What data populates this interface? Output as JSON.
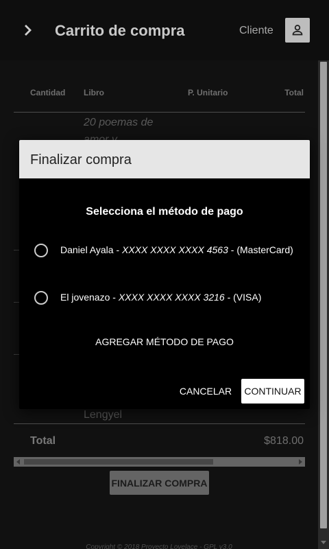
{
  "appbar": {
    "title": "Carrito de compra",
    "user_label": "Cliente",
    "menu_icon": "chevron-right-icon",
    "avatar_icon": "person-icon"
  },
  "table": {
    "headers": [
      "Cantidad",
      "Libro",
      "P. Unitario",
      "Total"
    ],
    "visible_book_title": "20 poemas de amor y",
    "visible_author": "Lengyel",
    "total_label": "Total",
    "total_value": "$818.00"
  },
  "finalize_button": "FINALIZAR COMPRA",
  "footer": "Copyright © 2018 Proyecto Lovelace - GPL v3.0",
  "dialog": {
    "title": "Finalizar compra",
    "subtitle": "Selecciona el método de pago",
    "methods": [
      {
        "name": "Daniel Ayala - ",
        "number": "XXXX XXXX XXXX 4563",
        "brand": " - (MasterCard)"
      },
      {
        "name": "El jovenazo - ",
        "number": "XXXX XXXX XXXX 3216",
        "brand": " - (VISA)"
      }
    ],
    "add_method": "AGREGAR MÉTODO DE PAGO",
    "cancel": "CANCELAR",
    "continue": "CONTINUAR"
  },
  "colors": {
    "appbar_bg": "#0e0e0e",
    "page_bg": "#1b1b1b",
    "dialog_header_bg": "#e6e6e6",
    "dialog_body_bg": "#000000"
  }
}
